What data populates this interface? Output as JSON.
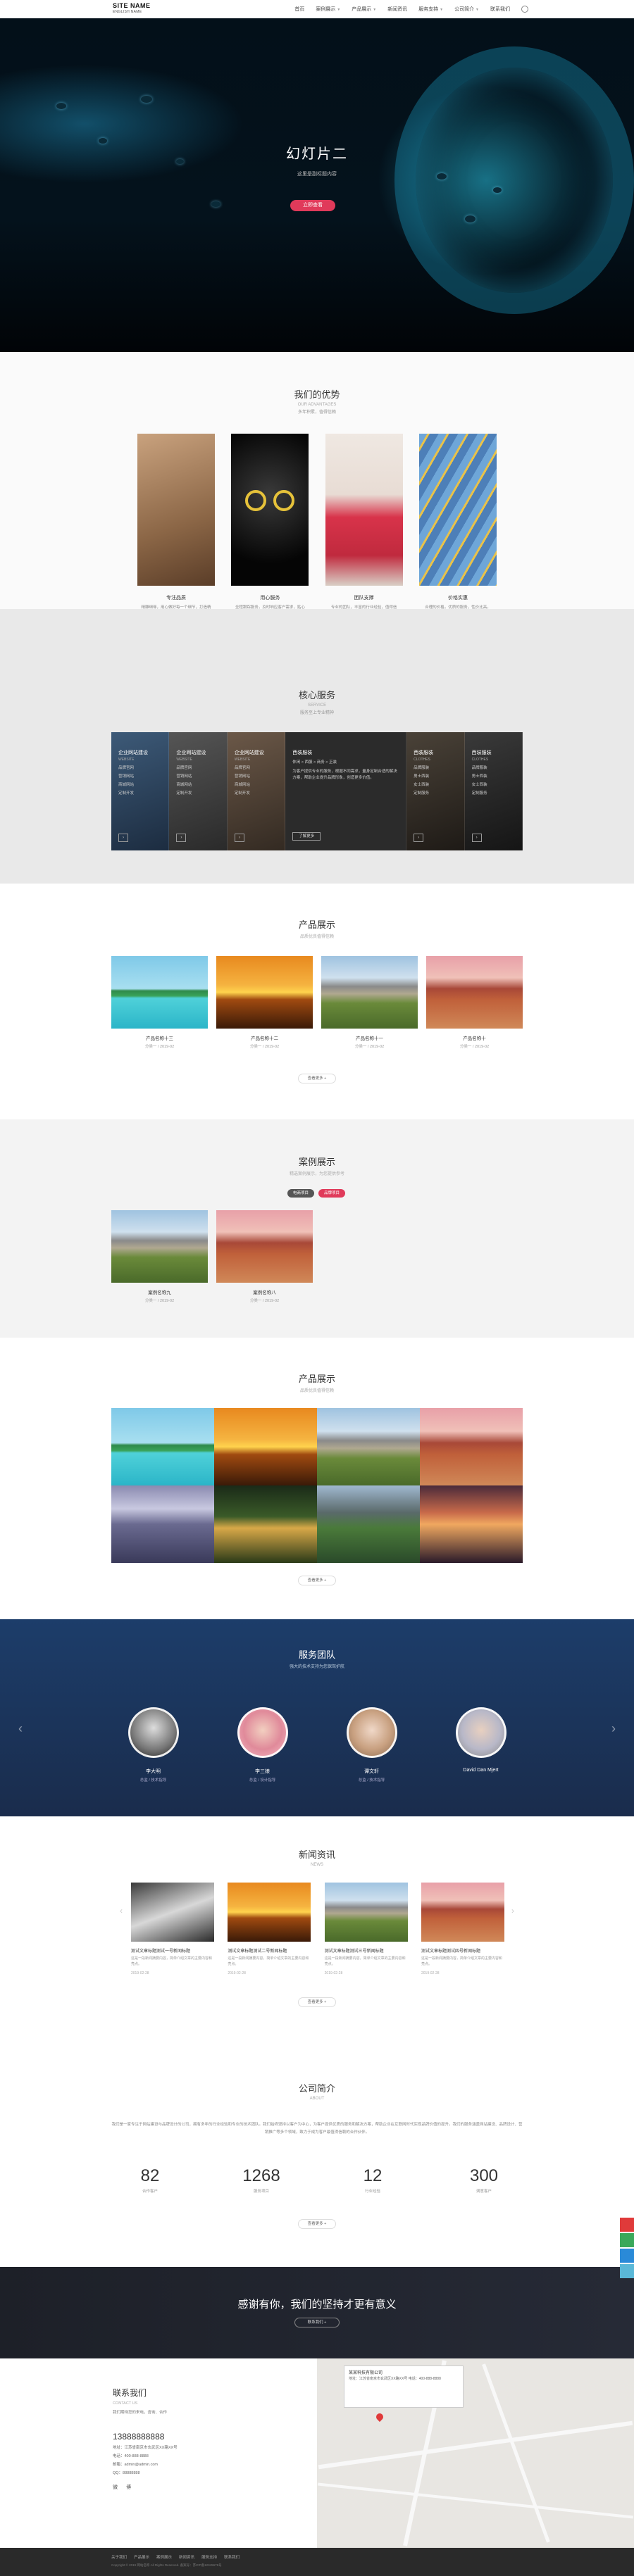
{
  "header": {
    "logo_line1": "SITE NAME",
    "logo_line2": "ENGLISH NAME",
    "nav": [
      "首页",
      "案例展示",
      "产品展示",
      "新闻资讯",
      "服务支持",
      "公司简介",
      "联系我们"
    ]
  },
  "hero": {
    "title": "幻灯片二",
    "subtitle": "这里是副标题内容",
    "button": "立即查看"
  },
  "advantages": {
    "title": "我们的优势",
    "en": "OUR ADVANTAGES",
    "desc": "多年积累，值得信赖",
    "items": [
      {
        "cap": "专注品质",
        "txt": "精雕细琢，用心做好每一个细节，打造精品。"
      },
      {
        "cap": "用心服务",
        "txt": "全程跟踪服务，及时响应客户需求，贴心周到。"
      },
      {
        "cap": "团队支撑",
        "txt": "专业的团队，丰富的行业经验，值得信赖。"
      },
      {
        "cap": "价格实惠",
        "txt": "合理的价格，优质的服务，性价比高。"
      }
    ]
  },
  "core": {
    "title": "核心服务",
    "en": "SERVICE",
    "desc": "服务至上专业精神",
    "cols": [
      {
        "title": "企业网站建设",
        "en": "WEBSITE",
        "items": [
          "品牌官网",
          "营销网站",
          "商城网站",
          "定制开发"
        ]
      },
      {
        "title": "企业网站建设",
        "en": "WEBSITE",
        "items": [
          "品牌官网",
          "营销网站",
          "商城网站",
          "定制开发"
        ]
      },
      {
        "title": "企业网站建设",
        "en": "WEBSITE",
        "items": [
          "品牌官网",
          "营销网站",
          "商城网站",
          "定制开发"
        ]
      },
      {
        "title": "西装服装",
        "en": "",
        "items": [
          "休闲 > 西服 > 商务 > 正装",
          "",
          "",
          ""
        ],
        "para": "为客户提供专业的服务，根据不同需求，量身定制合适的解决方案，帮助企业提升品牌形象，创造更多价值。",
        "button": "了解更多"
      },
      {
        "title": "西装服装",
        "en": "CLOTHES",
        "items": [
          "品牌服装",
          "男士西装",
          "女士西装",
          "定制服务"
        ]
      },
      {
        "title": "西装服装",
        "en": "CLOTHES",
        "items": [
          "品牌服装",
          "男士西装",
          "女士西装",
          "定制服务"
        ]
      }
    ]
  },
  "products1": {
    "title": "产品展示",
    "en": "品质优良值得信赖",
    "items": [
      {
        "name": "产品名称十三",
        "sub": "分类一 / 2019-02"
      },
      {
        "name": "产品名称十二",
        "sub": "分类一 / 2019-02"
      },
      {
        "name": "产品名称十一",
        "sub": "分类一 / 2019-02"
      },
      {
        "name": "产品名称十",
        "sub": "分类一 / 2019-02"
      }
    ],
    "more": "查看更多 +"
  },
  "cases": {
    "title": "案例展示",
    "en": "精选案例展示，为您提供参考",
    "tabs": [
      "电商项目",
      "品牌项目"
    ],
    "items": [
      {
        "name": "案例名称九",
        "sub": "分类一 / 2019-02"
      },
      {
        "name": "案例名称八",
        "sub": "分类一 / 2019-02"
      }
    ]
  },
  "products2": {
    "title": "产品展示",
    "en": "品质优良值得信赖",
    "more": "查看更多 +"
  },
  "team": {
    "title": "服务团队",
    "en": "强大的技术支持为您保驾护航",
    "members": [
      {
        "name": "李大明",
        "role": "总监 / 技术指导"
      },
      {
        "name": "李三娘",
        "role": "总监 / 设计指导"
      },
      {
        "name": "谭文轩",
        "role": "总监 / 技术指导"
      },
      {
        "name": "David Dan Mjert",
        "role": ""
      }
    ]
  },
  "news": {
    "title": "新闻资讯",
    "en": "NEWS",
    "items": [
      {
        "title": "测试文章标题测试一号新闻标题",
        "desc": "这是一段新闻摘要内容，简单介绍文章的主要内容和亮点。",
        "date": "2019-02-28"
      },
      {
        "title": "测试文章标题测试二号新闻标题",
        "desc": "这是一段新闻摘要内容，简单介绍文章的主要内容和亮点。",
        "date": "2019-02-28"
      },
      {
        "title": "测试文章标题测试三号新闻标题",
        "desc": "这是一段新闻摘要内容，简单介绍文章的主要内容和亮点。",
        "date": "2019-02-28"
      },
      {
        "title": "测试文章标题测试四号新闻标题",
        "desc": "这是一段新闻摘要内容，简单介绍文章的主要内容和亮点。",
        "date": "2019-02-28"
      }
    ],
    "more": "查看更多 +"
  },
  "intro": {
    "title": "公司简介",
    "en": "ABOUT",
    "para": "我们是一家专注于网站建设与品牌设计的公司，拥有多年的行业经验和专业的技术团队。我们始终坚持以客户为中心，为客户提供优质的服务和解决方案，帮助企业在互联网时代实现品牌价值的提升。我们的服务涵盖网站建设、品牌设计、营销推广等多个领域，致力于成为客户最值得信赖的合作伙伴。",
    "stats": [
      {
        "num": "82",
        "label": "合作客户"
      },
      {
        "num": "1268",
        "label": "服务项目"
      },
      {
        "num": "12",
        "label": "行业经验"
      },
      {
        "num": "300",
        "label": "满意客户"
      }
    ],
    "more": "查看更多 +"
  },
  "cta": {
    "text": "感谢有你，我们的坚持才更有意义",
    "button": "联系我们 +"
  },
  "contact": {
    "title": "联系我们",
    "en": "CONTACT US",
    "line": "我们期待您的来电，咨询、合作",
    "phone": "13888888888",
    "info": [
      "地址：江苏省南京市玄武区XX路XX号",
      "电话：400-888-8888",
      "邮箱：admin@admin.com",
      "QQ：88888888"
    ],
    "icons": [
      "微",
      "博"
    ],
    "map_popup_title": "某某科技有限公司",
    "map_popup_text": "地址：江苏省南京市玄武区XX路XX号 电话：400-888-8888"
  },
  "footer": {
    "links": [
      "关于我们",
      "产品展示",
      "案例展示",
      "新闻资讯",
      "服务支持",
      "联系我们"
    ],
    "copy": "Copyright © 2019 网站名称 All Rights Reserved. 备案号：苏ICP备12345678号"
  },
  "colors": {
    "accent": "#e03a5a",
    "team_bg": "#1c3d6a",
    "cta_bg": "#1d2028",
    "footer_bg": "#2a2a2a"
  }
}
